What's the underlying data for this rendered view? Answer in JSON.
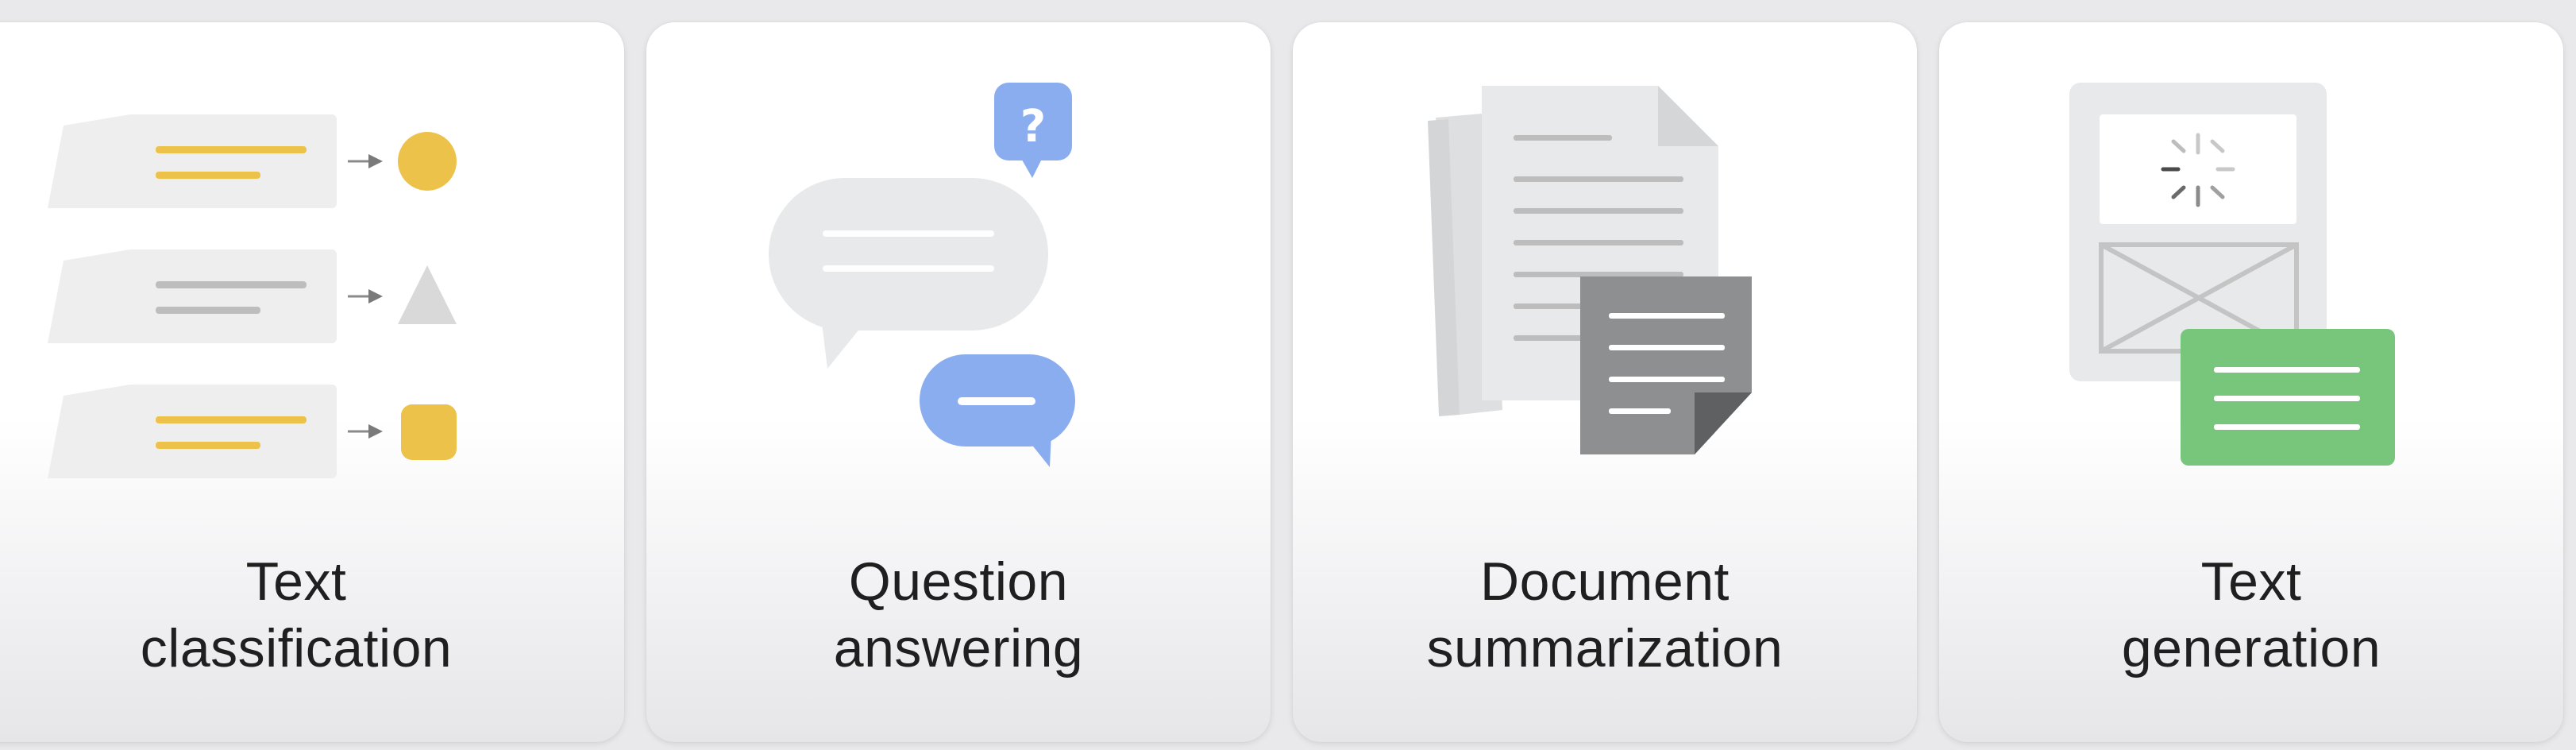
{
  "cards": [
    {
      "line1": "Text",
      "line2": "classification",
      "icon": "text-classification-icon"
    },
    {
      "line1": "Question",
      "line2": "answering",
      "icon": "question-answering-icon",
      "badge": "?"
    },
    {
      "line1": "Document",
      "line2": "summarization",
      "icon": "document-summarization-icon"
    },
    {
      "line1": "Text",
      "line2": "generation",
      "icon": "text-generation-icon"
    }
  ],
  "colors": {
    "yellow": "#EDC24B",
    "gray_line": "#BDBDBD",
    "light_gray": "#E8E9EB",
    "blue": "#8AADF0",
    "dark_gray": "#8E8F91",
    "green": "#78C57C"
  }
}
